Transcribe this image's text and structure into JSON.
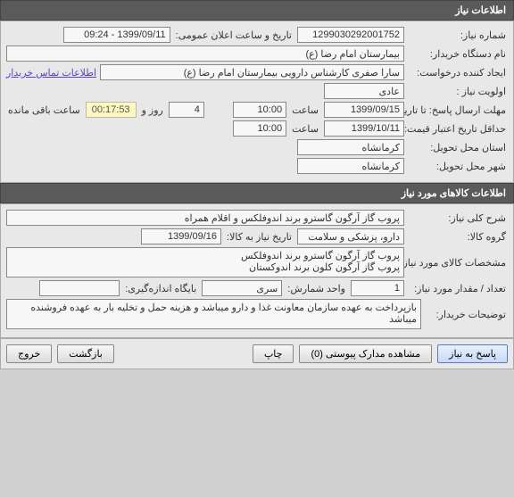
{
  "section1": {
    "title": "اطلاعات نیاز"
  },
  "need": {
    "number_label": "شماره نیاز:",
    "number": "1299030292001752",
    "public_date_label": "تاریخ و ساعت اعلان عمومی:",
    "public_date": "1399/09/11 - 09:24",
    "buyer_label": "نام دستگاه خریدار:",
    "buyer": "بیمارستان امام رضا (ع)",
    "creator_label": "ایجاد کننده درخواست:",
    "creator": "سارا صفری کارشناس دارویی بیمارستان امام رضا (ع)",
    "contact_link": "اطلاعات تماس خریدار",
    "priority_label": "اولویت نیاز :",
    "priority": "عادی",
    "deadline_label": "مهلت ارسال پاسخ:",
    "to_date_label": "تا تاریخ :",
    "deadline_date": "1399/09/15",
    "time_label": "ساعت",
    "deadline_time": "10:00",
    "days_label_pre": " ",
    "days": "4",
    "days_label": "روز و",
    "countdown": "00:17:53",
    "remaining_label": "ساعت باقی مانده",
    "min_validity_label": "حداقل تاریخ اعتبار قیمت:",
    "min_validity_date": "1399/10/11",
    "min_validity_time": "10:00",
    "delivery_province_label": "استان محل تحویل:",
    "delivery_province": "کرمانشاه",
    "delivery_city_label": "شهر محل تحویل:",
    "delivery_city": "کرمانشاه"
  },
  "section2": {
    "title": "اطلاعات کالاهای مورد نیاز"
  },
  "goods": {
    "desc_label": "شرح کلی نیاز:",
    "desc": "پروب گاز آرگون گاسترو برند اندوفلکس و اقلام همراه",
    "group_label": "گروه کالا:",
    "group": "دارو، پزشکی و سلامت",
    "need_date_label": "تاریخ نیاز به کالا:",
    "need_date": "1399/09/16",
    "spec_label": "مشخصات کالای مورد نیاز:",
    "spec": "پروب گاز آرگون گاسترو برند اندوفلکس\nپروب گاز آرگون کلون برند اندوکستان",
    "qty_label": "تعداد / مقدار مورد نیاز:",
    "qty": "1",
    "unit_label": "واحد شمارش:",
    "unit": "سری",
    "sub_unit_label": "بایگاه اندازه‌گیری:",
    "sub_unit": "",
    "notes_label": "توضیحات خریدار:",
    "notes": "بازپرداخت به عهده سازمان معاونت غذا و دارو میباشد و هزینه حمل و تخلیه بار به عهده فروشنده میباشد"
  },
  "footer": {
    "reply": "پاسخ به نیاز",
    "attachments": "مشاهده مدارک پیوستی   (0)",
    "print": "چاپ",
    "back": "بازگشت",
    "exit": "خروج"
  }
}
